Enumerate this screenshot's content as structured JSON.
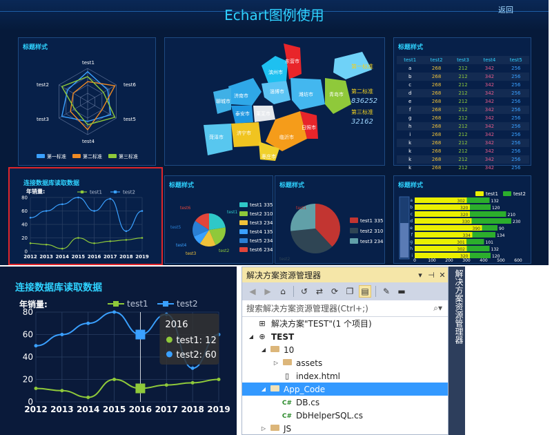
{
  "dashboard": {
    "title": "Echart图例使用",
    "back_label": "返回",
    "radar": {
      "title": "标题样式",
      "indicators": [
        "test1",
        "test6",
        "test5",
        "test4",
        "test3",
        "test2"
      ],
      "legend": [
        "第一标准",
        "第二标准",
        "第三标准"
      ],
      "colors": [
        "#3aa0ff",
        "#f08a24",
        "#8fc93a"
      ]
    },
    "map": {
      "legend_items": [
        "第一标准",
        "第二标准",
        "第三标准"
      ],
      "values": [
        "836252",
        "32162"
      ],
      "cities": [
        "济南市",
        "滨州市",
        "东营市",
        "淄博市",
        "潍坊市",
        "青岛市",
        "聊城市",
        "泰安市",
        "莱芜市",
        "济宁市",
        "枣庄市",
        "临沂市",
        "日照市",
        "菏泽市"
      ]
    },
    "table_panel": {
      "title": "标题样式",
      "headers": [
        "test1",
        "test2",
        "test3",
        "test4",
        "test5"
      ],
      "rows": [
        [
          "a",
          "268",
          "212",
          "342",
          "256"
        ],
        [
          "b",
          "268",
          "212",
          "342",
          "256"
        ],
        [
          "c",
          "268",
          "212",
          "342",
          "256"
        ],
        [
          "d",
          "268",
          "212",
          "342",
          "256"
        ],
        [
          "e",
          "268",
          "212",
          "342",
          "256"
        ],
        [
          "f",
          "268",
          "212",
          "342",
          "256"
        ],
        [
          "g",
          "268",
          "212",
          "342",
          "256"
        ],
        [
          "h",
          "268",
          "212",
          "342",
          "256"
        ],
        [
          "i",
          "268",
          "212",
          "342",
          "256"
        ],
        [
          "k",
          "268",
          "212",
          "342",
          "256"
        ],
        [
          "k",
          "268",
          "212",
          "342",
          "256"
        ],
        [
          "k",
          "268",
          "212",
          "342",
          "256"
        ],
        [
          "k",
          "268",
          "212",
          "342",
          "256"
        ]
      ]
    },
    "db_panel": {
      "title": "连接数据库读取数据",
      "sales_label": "年销量:"
    },
    "pie1": {
      "title": "标题样式",
      "labels": [
        "test1",
        "test2",
        "test3",
        "test4",
        "test5",
        "test6"
      ],
      "legend": [
        "test1 335",
        "test2 310",
        "test3 234",
        "test4 135",
        "test5 234",
        "test6 234"
      ],
      "colors": [
        "#2fc8c8",
        "#8fc93a",
        "#f0c23a",
        "#3aa0ff",
        "#2a7fd4",
        "#e1453a"
      ]
    },
    "pie2": {
      "title": "标题样式",
      "labels": [
        "test1",
        "test2"
      ],
      "legend": [
        "test1 335",
        "test2 310",
        "test3 234"
      ],
      "colors": [
        "#c23531",
        "#2f4554",
        "#61a0a8"
      ]
    },
    "bar_panel": {
      "title": "标题样式",
      "legend": [
        "test1",
        "test2"
      ],
      "test1": [
        302,
        320,
        320,
        330,
        390,
        334,
        301,
        302,
        320
      ],
      "test2": [
        132,
        120,
        210,
        230,
        90,
        134,
        101,
        132,
        120
      ],
      "categories": [
        "a",
        "b",
        "c",
        "d",
        "e",
        "f",
        "g",
        "h",
        "i"
      ],
      "xticks": [
        "0",
        "100",
        "200",
        "300",
        "400",
        "500",
        "600"
      ],
      "colors": [
        "#eaf000",
        "#2cae2c"
      ]
    }
  },
  "line_panel": {
    "title": "连接数据库读取数据",
    "sales_label": "年销量:",
    "tooltip": {
      "year": "2016",
      "l1": "test1: 12",
      "l2": "test2: 60"
    }
  },
  "chart_data": {
    "type": "line",
    "x": [
      "2012",
      "2013",
      "2014",
      "2015",
      "2016",
      "2017",
      "2018",
      "2019"
    ],
    "series": [
      {
        "name": "test1",
        "values": [
          12,
          10,
          4,
          20,
          12,
          15,
          17,
          20
        ],
        "color": "#8fc93a"
      },
      {
        "name": "test2",
        "values": [
          50,
          60,
          70,
          80,
          60,
          78,
          30,
          60
        ],
        "color": "#3aa0ff"
      }
    ],
    "yticks": [
      "0",
      "20",
      "40",
      "60",
      "80"
    ],
    "ylim": [
      0,
      80
    ]
  },
  "solution_explorer": {
    "title": "解决方案资源管理器",
    "search_placeholder": "搜索解决方案资源管理器(Ctrl+;)",
    "tree": [
      {
        "indent": 0,
        "twisty": "",
        "icon": "solution-icon",
        "label": "解决方案\"TEST\"(1 个项目)",
        "bold": false,
        "selected": false
      },
      {
        "indent": 0,
        "twisty": "◢",
        "icon": "globe-icon",
        "label": "TEST",
        "bold": true,
        "selected": false
      },
      {
        "indent": 1,
        "twisty": "◢",
        "icon": "folder-icon",
        "label": "10",
        "bold": false,
        "selected": false
      },
      {
        "indent": 2,
        "twisty": "▷",
        "icon": "folder-icon",
        "label": "assets",
        "bold": false,
        "selected": false
      },
      {
        "indent": 2,
        "twisty": "",
        "icon": "html-file-icon",
        "label": "index.html",
        "bold": false,
        "selected": false
      },
      {
        "indent": 1,
        "twisty": "◢",
        "icon": "folder-icon",
        "label": "App_Code",
        "bold": false,
        "selected": true
      },
      {
        "indent": 2,
        "twisty": "",
        "icon": "cs-file-icon",
        "label": "DB.cs",
        "bold": false,
        "selected": false
      },
      {
        "indent": 2,
        "twisty": "",
        "icon": "cs-file-icon",
        "label": "DbHelperSQL.cs",
        "bold": false,
        "selected": false
      },
      {
        "indent": 1,
        "twisty": "▷",
        "icon": "folder-icon",
        "label": "JS",
        "bold": false,
        "selected": false
      }
    ],
    "vertical_tab": "解决方案资源管理器"
  }
}
